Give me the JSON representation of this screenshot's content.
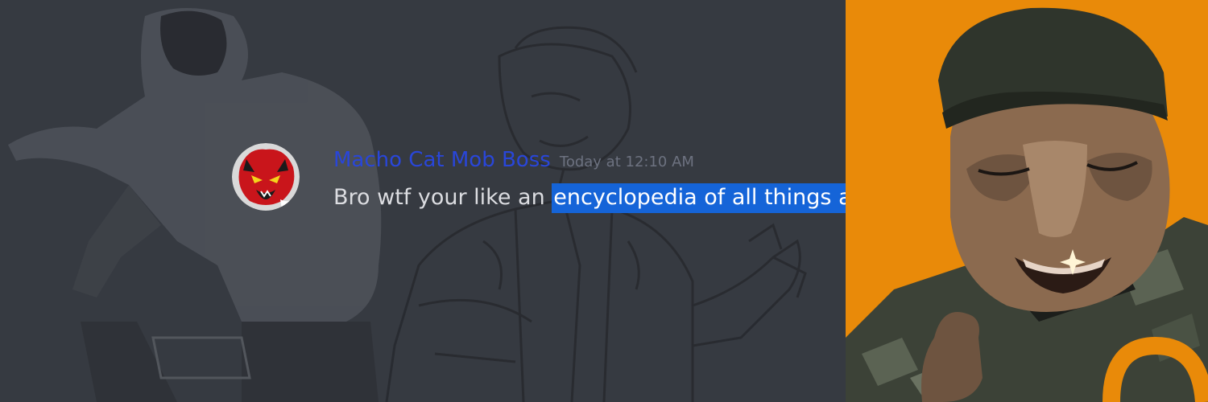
{
  "message": {
    "username": "Macho Cat Mob Boss",
    "timestamp": "Today at 12:10 AM",
    "text_plain": "Bro wtf your like an ",
    "text_highlighted": "encyclopedia of all things art"
  },
  "colors": {
    "chat_background": "#36393f",
    "username": "#2946d9",
    "timestamp": "#6d7280",
    "message_text": "#dcdde1",
    "selection_highlight": "#1564d8",
    "portrait_background": "#e98a09"
  },
  "icons": {
    "avatar": "red-cat-avatar-icon"
  }
}
